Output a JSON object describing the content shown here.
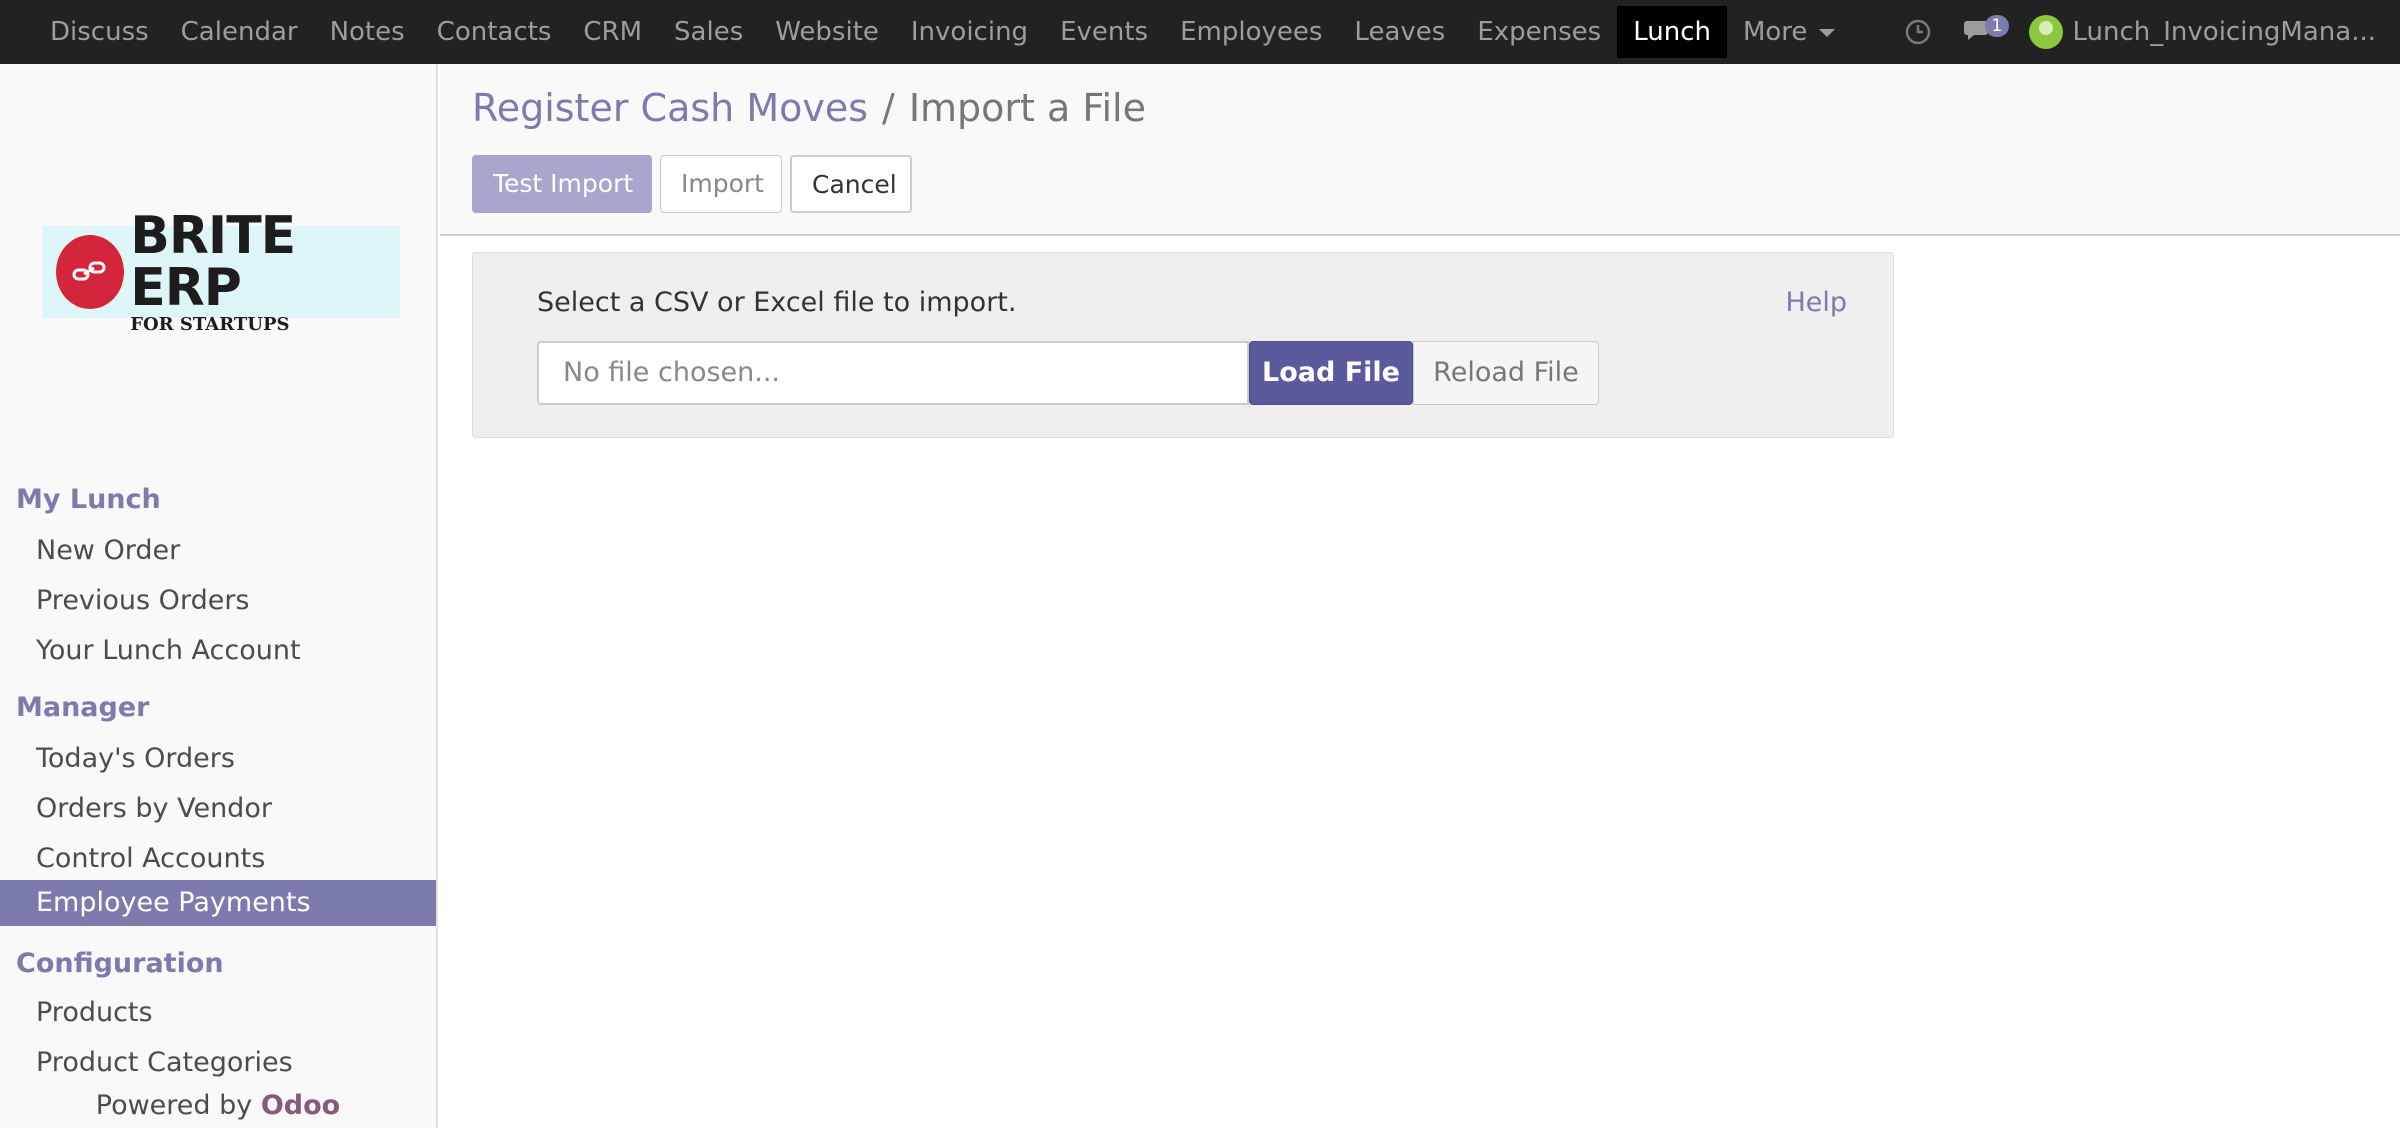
{
  "topbar": {
    "apps": [
      "Discuss",
      "Calendar",
      "Notes",
      "Contacts",
      "CRM",
      "Sales",
      "Website",
      "Invoicing",
      "Events",
      "Employees",
      "Leaves",
      "Expenses",
      "Lunch"
    ],
    "active_app": "Lunch",
    "more_label": "More",
    "chat_badge_count": "1",
    "user_name": "Lunch_InvoicingMana..."
  },
  "sidebar": {
    "logo": {
      "brand": "BRITE ERP",
      "sub": "FOR STARTUPS"
    },
    "sections": [
      {
        "title": "My Lunch",
        "items": [
          "New Order",
          "Previous Orders",
          "Your Lunch Account"
        ]
      },
      {
        "title": "Manager",
        "items": [
          "Today's Orders",
          "Orders by Vendor",
          "Control Accounts",
          "Employee Payments"
        ]
      },
      {
        "title": "Configuration",
        "items": [
          "Products",
          "Product Categories"
        ]
      }
    ],
    "active_item": "Employee Payments",
    "powered_by": "Powered by",
    "powered_brand": "Odoo"
  },
  "control_panel": {
    "breadcrumb_parent": "Register Cash Moves",
    "breadcrumb_separator": "/",
    "breadcrumb_current": "Import a File",
    "test_import_label": "Test Import",
    "import_label": "Import",
    "cancel_label": "Cancel"
  },
  "import_box": {
    "instruction": "Select a CSV or Excel file to import.",
    "help_label": "Help",
    "file_placeholder": "No file chosen...",
    "load_label": "Load File",
    "reload_label": "Reload File"
  },
  "colors": {
    "topbar_bg": "#222222",
    "accent": "#7c7bad",
    "primary_button": "#5b5a9d",
    "brand_red": "#d5253a",
    "odoo": "#875a7b"
  }
}
